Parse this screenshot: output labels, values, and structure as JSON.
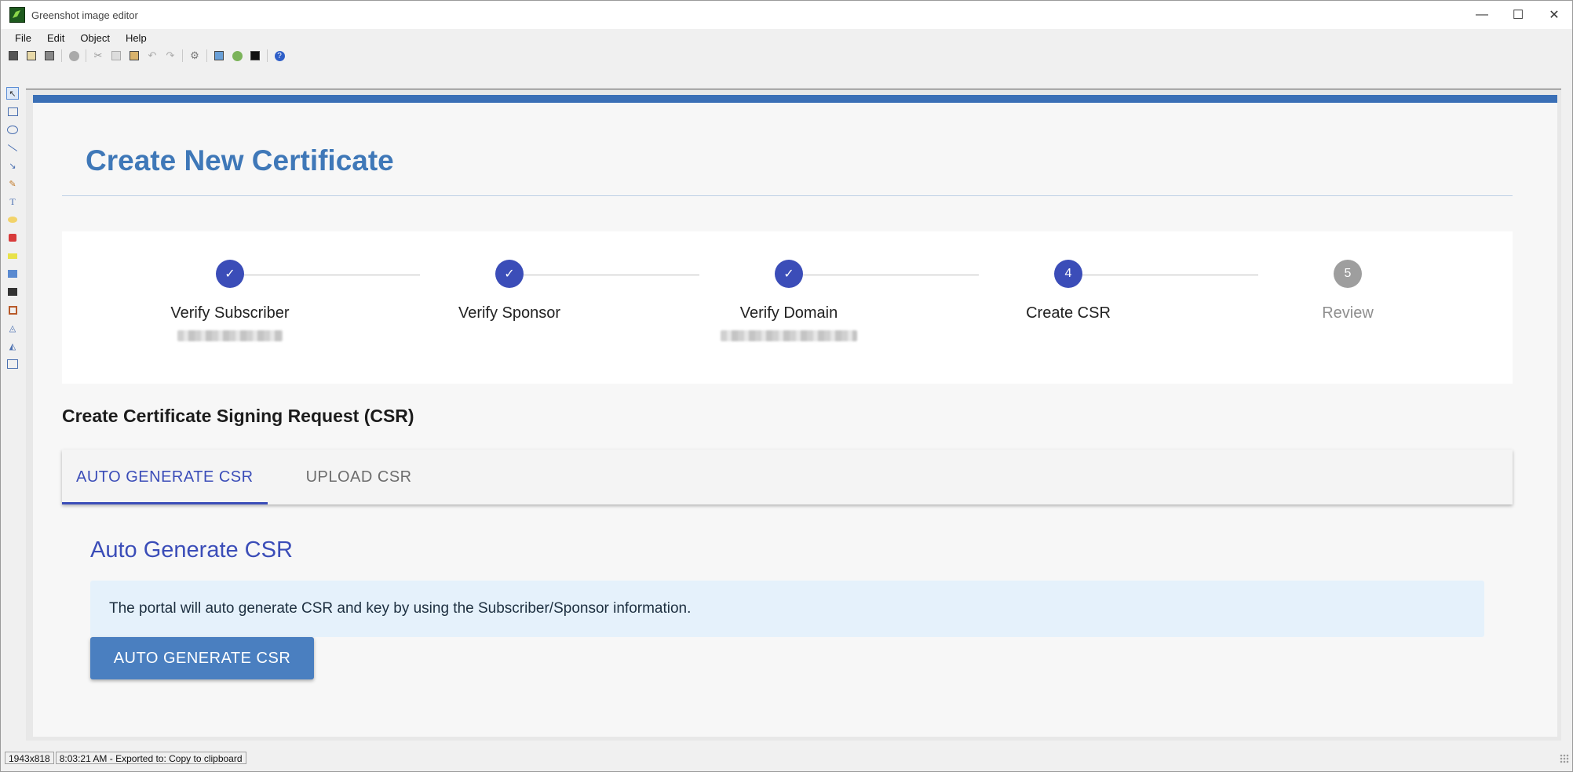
{
  "window": {
    "title": "Greenshot image editor",
    "controls": {
      "minimize": "—",
      "maximize": "☐",
      "close": "✕"
    }
  },
  "menu": [
    "File",
    "Edit",
    "Object",
    "Help"
  ],
  "toolbar_icons": [
    "save-icon",
    "clipboard-icon",
    "print-icon",
    "delete-icon",
    "cut-icon",
    "copy-icon",
    "paste-icon",
    "undo-icon",
    "redo-icon",
    "settings-icon",
    "export-icon",
    "upload-icon",
    "info-icon",
    "help-icon"
  ],
  "tool_icons": [
    "cursor-tool-icon",
    "rectangle-tool-icon",
    "ellipse-tool-icon",
    "line-tool-icon",
    "arrow-tool-icon",
    "freehand-tool-icon",
    "text-tool-icon",
    "speechbubble-tool-icon",
    "counter-tool-icon",
    "highlight-tool-icon",
    "obfuscate-tool-icon",
    "effects-tool-icon",
    "crop-tool-icon",
    "rotate-tool-icon",
    "flip-tool-icon",
    "resize-tool-icon"
  ],
  "page": {
    "title": "Create New Certificate",
    "stepper": [
      {
        "label": "Verify Subscriber",
        "state": "done",
        "icon": "check-icon"
      },
      {
        "label": "Verify Sponsor",
        "state": "done",
        "icon": "check-icon"
      },
      {
        "label": "Verify Domain",
        "state": "done",
        "icon": "check-icon"
      },
      {
        "label": "Create CSR",
        "state": "current",
        "number": "4"
      },
      {
        "label": "Review",
        "state": "pending",
        "number": "5"
      }
    ],
    "section_heading": "Create Certificate Signing Request (CSR)",
    "tabs": [
      "AUTO GENERATE CSR",
      "UPLOAD CSR"
    ],
    "active_tab": "AUTO GENERATE CSR",
    "subsection_title": "Auto Generate CSR",
    "info_text": "The portal will auto generate CSR and key by using the Subscriber/Sponsor information.",
    "button_label": "AUTO GENERATE CSR"
  },
  "status": {
    "dimensions": "1943x818",
    "message": "8:03:21 AM - Exported to: Copy to clipboard"
  },
  "colors": {
    "accent": "#3b4db8",
    "title_blue": "#3f78b8",
    "button_blue": "#4a7fc0",
    "info_bg": "#e5f1fb",
    "pending_gray": "#9e9e9e"
  }
}
